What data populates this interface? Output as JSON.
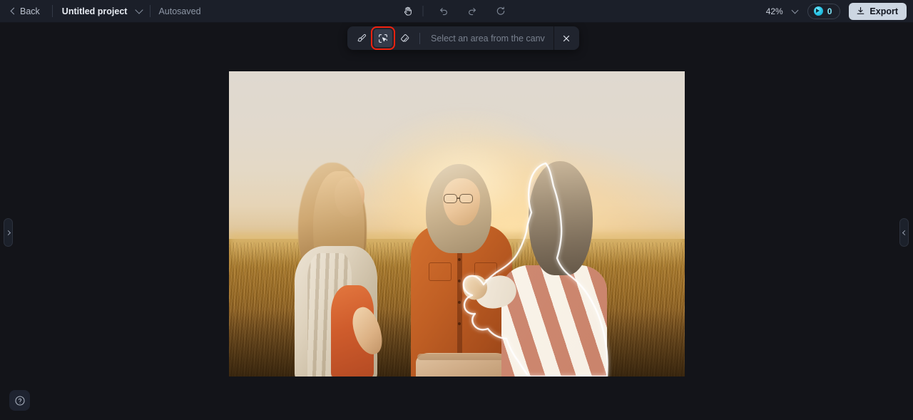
{
  "header": {
    "back_label": "Back",
    "project_name": "Untitled project",
    "save_status": "Autosaved",
    "zoom_level": "42%",
    "credits_count": "0",
    "export_label": "Export",
    "center_tools": [
      {
        "name": "pan-hand-icon",
        "title": "Pan"
      },
      {
        "name": "undo-icon",
        "title": "Undo"
      },
      {
        "name": "redo-icon",
        "title": "Redo"
      },
      {
        "name": "reset-icon",
        "title": "Reset"
      }
    ]
  },
  "selection_toolbar": {
    "tools": [
      {
        "name": "brush-tool",
        "label": "Brush"
      },
      {
        "name": "select-area-tool",
        "label": "Select area"
      },
      {
        "name": "eraser-tool",
        "label": "Eraser"
      }
    ],
    "active_tool": "select-area-tool",
    "input_placeholder": "Select an area from the canvas",
    "input_value": "",
    "close_label": "Close"
  },
  "canvas": {
    "photo_alt": "Three women laughing together in a golden wheat field at sunset",
    "selection_active": true,
    "selected_subject": "woman-in-striped-shirt"
  },
  "panels": {
    "left_handle_label": "Open left panel",
    "right_handle_label": "Open right panel"
  },
  "help": {
    "label": "Help"
  },
  "colors": {
    "app_background": "#131419",
    "header_background": "#1b1f29",
    "toolbar_background": "#20242e",
    "accent_credit": "#2bc6e8",
    "export_button": "#ccd6e2",
    "highlight_box": "#f2220f",
    "selection_outline": "#ffffff"
  }
}
